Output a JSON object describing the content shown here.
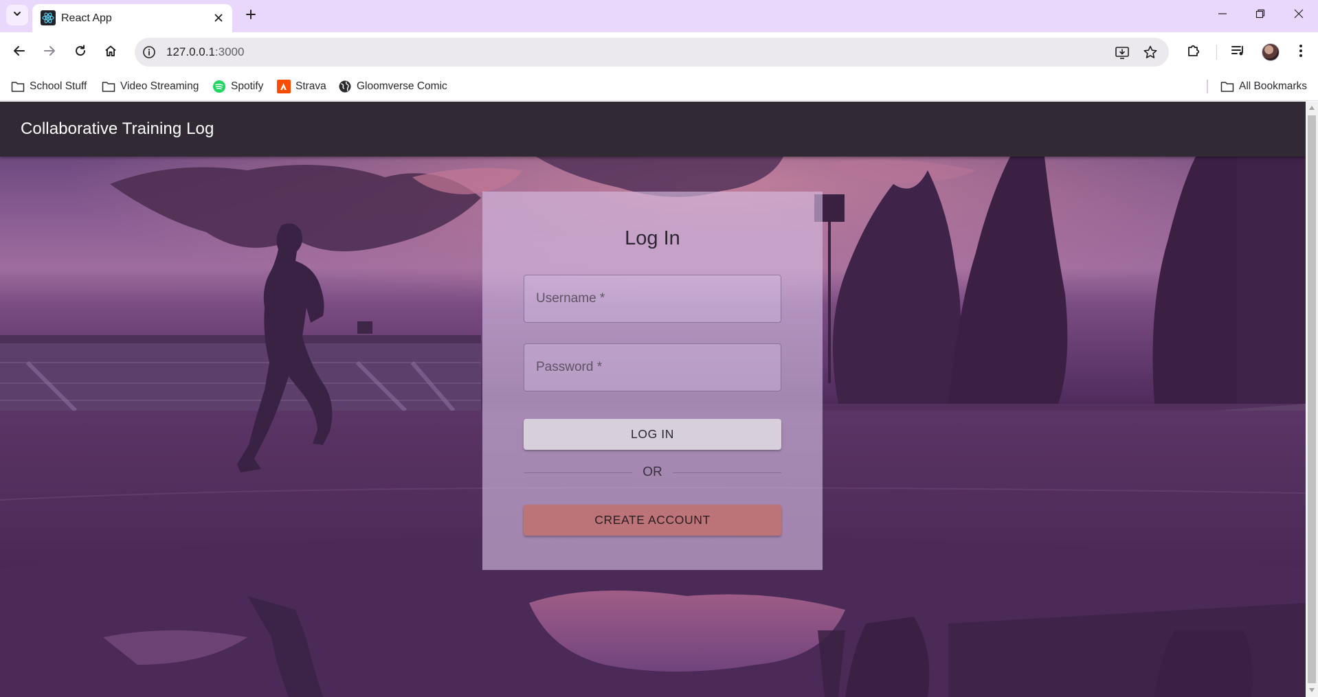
{
  "browser": {
    "tab_title": "React App",
    "url_host": "127.0.0.1",
    "url_port": ":3000",
    "bookmarks": [
      {
        "label": "School Stuff",
        "icon": "folder-icon"
      },
      {
        "label": "Video Streaming",
        "icon": "folder-icon"
      },
      {
        "label": "Spotify",
        "icon": "spotify-icon"
      },
      {
        "label": "Strava",
        "icon": "strava-icon"
      },
      {
        "label": "Gloomverse Comic",
        "icon": "globe-icon"
      }
    ],
    "all_bookmarks": "All Bookmarks",
    "accent": "#e9d8fb"
  },
  "app": {
    "title": "Collaborative Training Log",
    "bar_color": "#312a34"
  },
  "login": {
    "heading": "Log In",
    "username_placeholder": "Username *",
    "password_placeholder": "Password *",
    "login_button": "LOG IN",
    "divider_text": "OR",
    "create_button": "CREATE ACCOUNT",
    "create_color": "#bd7478"
  }
}
